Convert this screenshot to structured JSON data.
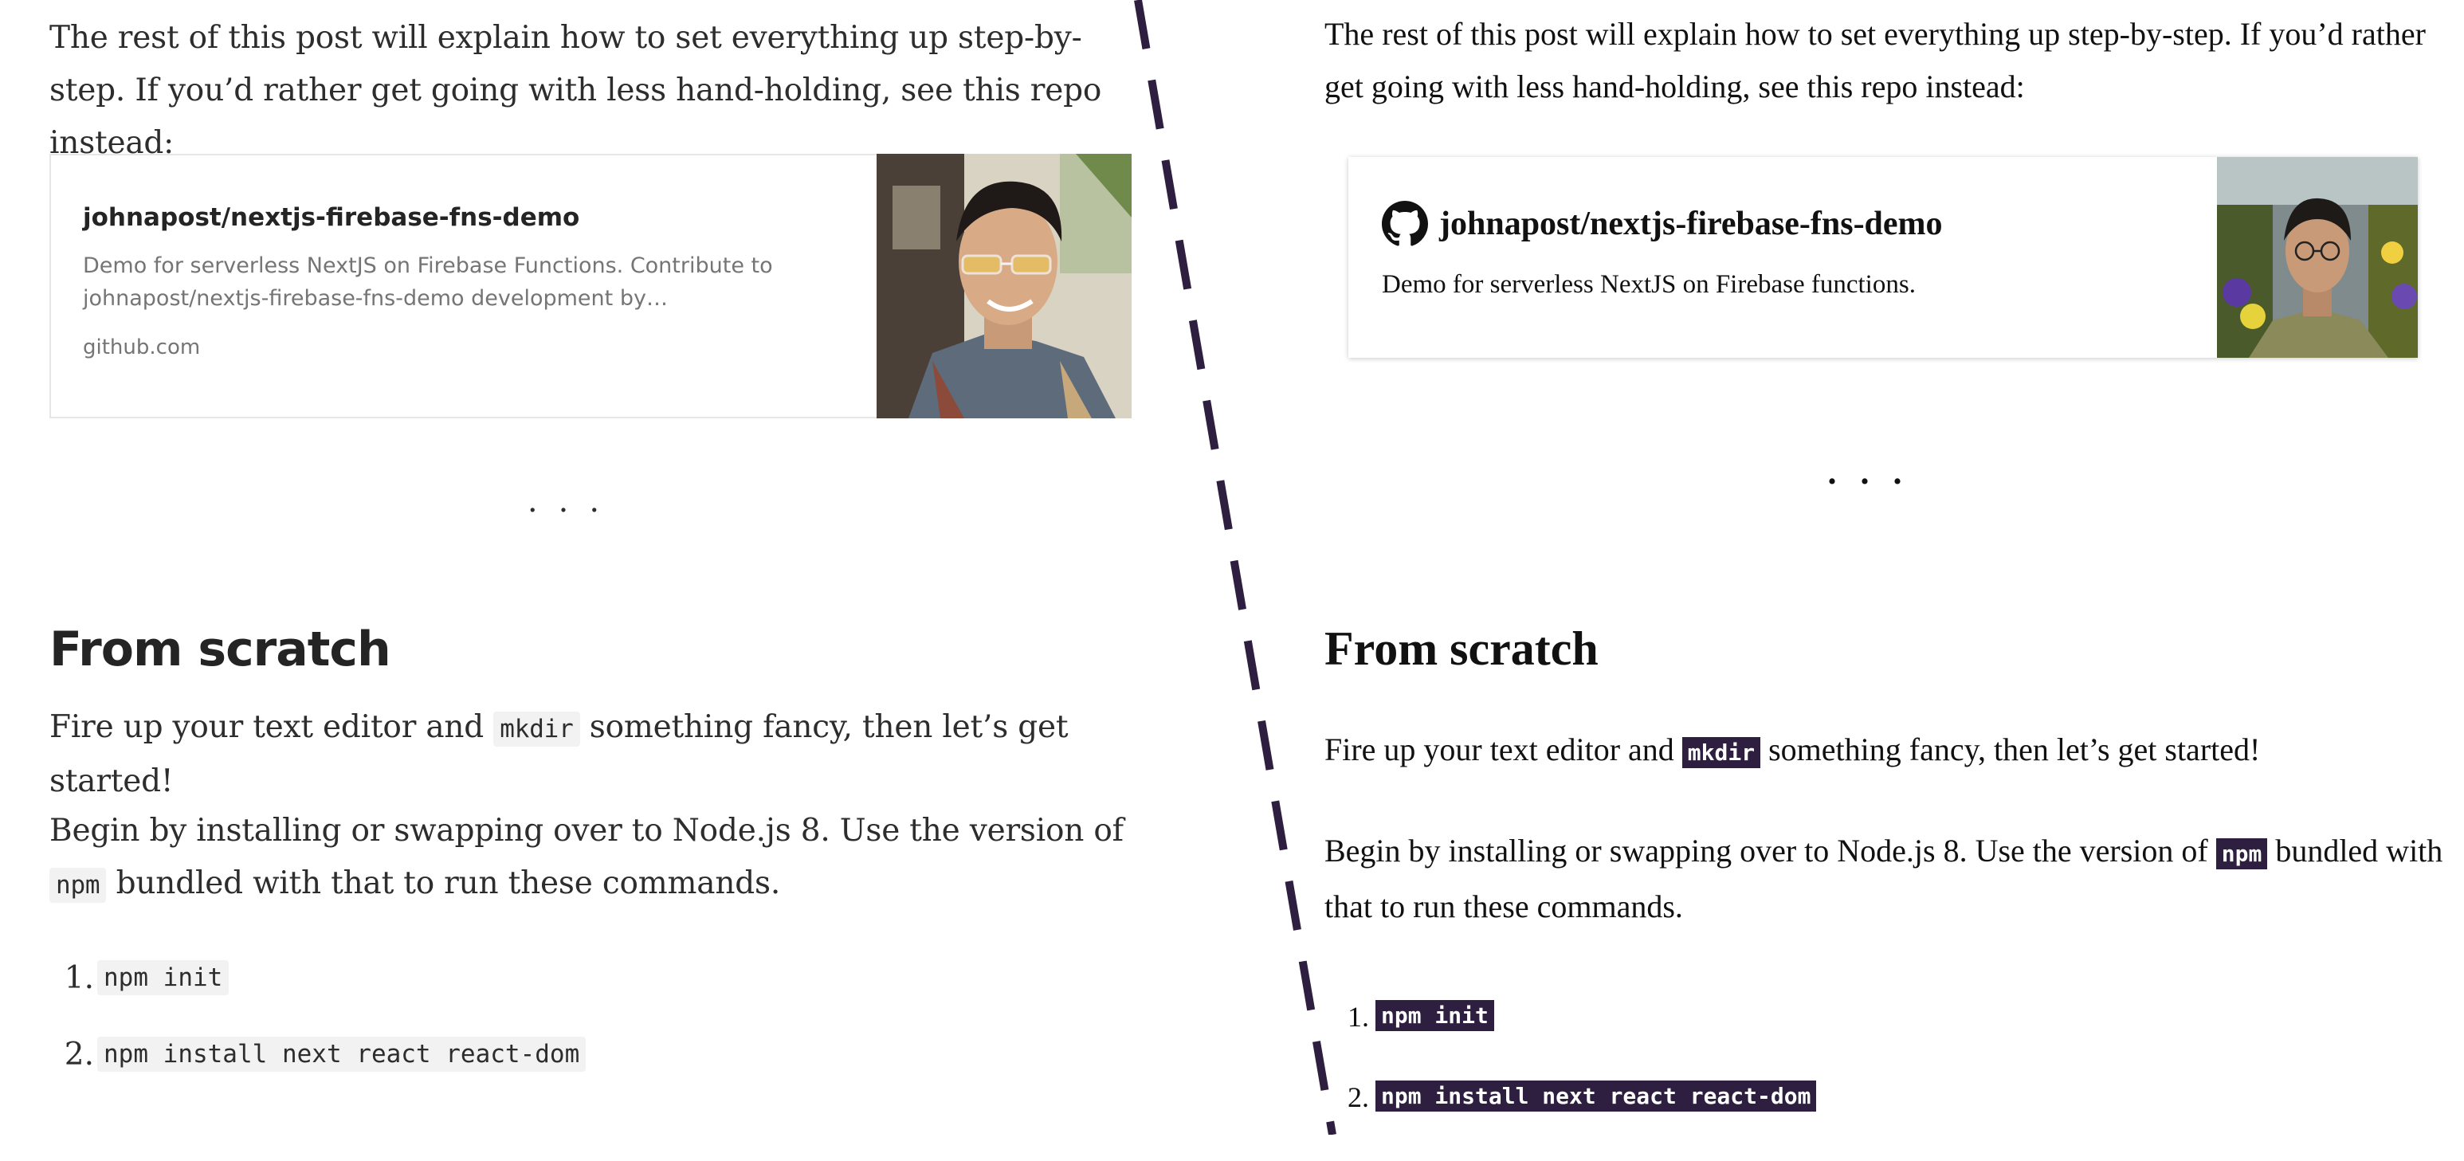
{
  "left": {
    "intro": "The rest of this post will explain how to set everything up step-by-step. If you’d rather get going with less hand-holding, see this repo instead:",
    "card": {
      "title": "johnapost/nextjs-firebase-fns-demo",
      "description": "Demo for serverless NextJS on Firebase Functions. Contribute to johnapost/nextjs-firebase-fns-demo development by…",
      "host": "github.com"
    },
    "separator": "...",
    "heading": "From scratch",
    "p1_before": "Fire up your text editor and ",
    "p1_code": "mkdir",
    "p1_after": " something fancy, then let’s get started!",
    "p2_before": "Begin by installing or swapping over to Node.js 8. Use the version of ",
    "p2_code": "npm",
    "p2_after": " bundled with that to run these commands.",
    "steps": [
      {
        "num": "1.",
        "code": "npm init"
      },
      {
        "num": "2.",
        "code": "npm install next react react-dom"
      }
    ]
  },
  "right": {
    "intro": "The rest of this post will explain how to set everything up step-by-step. If you’d rather get going with less hand-holding, see this repo instead:",
    "card": {
      "title": "johnapost/nextjs-firebase-fns-demo",
      "description": "Demo for serverless NextJS on Firebase functions."
    },
    "separator": "...",
    "heading": "From scratch",
    "p1_before": "Fire up your text editor and ",
    "p1_code": "mkdir",
    "p1_after": " something fancy, then let’s get started!",
    "p2_before": "Begin by installing or swapping over to Node.js 8. Use the version of ",
    "p2_code": "npm",
    "p2_after": " bundled with that to run these commands.",
    "steps": [
      {
        "num": "1.",
        "code": "npm init"
      },
      {
        "num": "2.",
        "code": "npm install next react react-dom"
      }
    ]
  },
  "colors": {
    "divider": "#2e1f40",
    "code_bg_dark": "#2e1f40",
    "code_bg_light": "#f2f2f2"
  },
  "icons": {
    "card_brand": "github-icon"
  }
}
